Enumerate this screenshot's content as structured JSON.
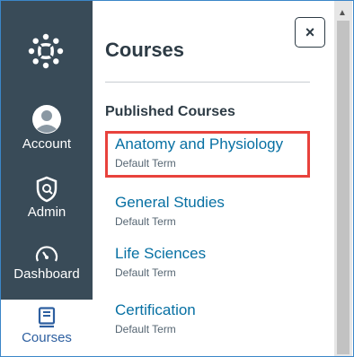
{
  "nav": {
    "items": [
      {
        "label": "Account",
        "icon": "user-icon"
      },
      {
        "label": "Admin",
        "icon": "shield-icon"
      },
      {
        "label": "Dashboard",
        "icon": "speedometer-icon"
      },
      {
        "label": "Courses",
        "icon": "book-icon"
      }
    ]
  },
  "tray": {
    "title": "Courses",
    "close_label": "×",
    "section_title": "Published Courses",
    "courses": [
      {
        "name": "Anatomy and Physiology",
        "term": "Default Term"
      },
      {
        "name": "General Studies",
        "term": "Default Term"
      },
      {
        "name": "Life Sciences",
        "term": "Default Term"
      },
      {
        "name": "Certification",
        "term": "Default Term"
      }
    ]
  },
  "colors": {
    "nav_bg": "#394b58",
    "link": "#0770a3",
    "highlight": "#e8423c"
  }
}
